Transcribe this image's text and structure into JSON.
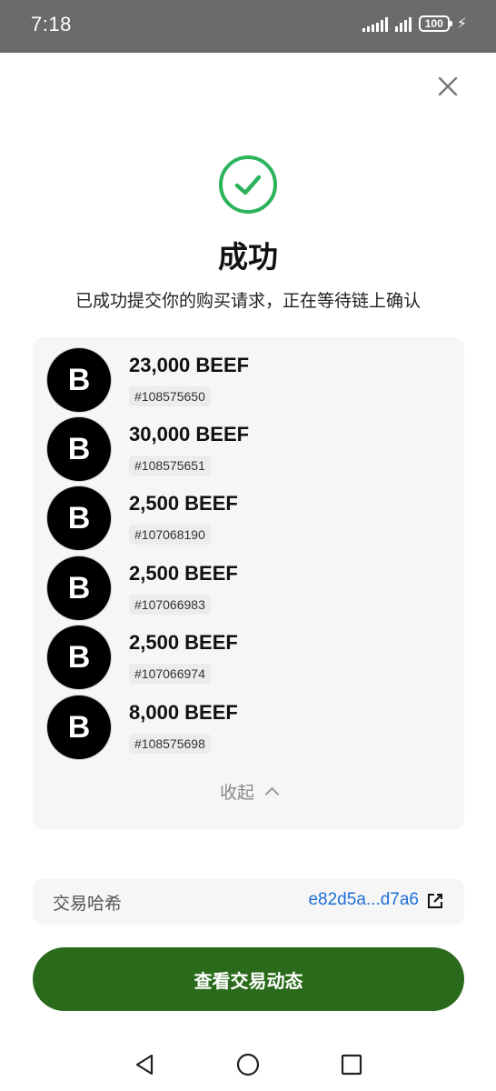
{
  "status_bar": {
    "time": "7:18",
    "battery": "100"
  },
  "result": {
    "title": "成功",
    "message": "已成功提交你的购买请求，正在等待链上确认"
  },
  "items": [
    {
      "avatar_letter": "B",
      "amount": "23,000 BEEF",
      "id": "#108575650"
    },
    {
      "avatar_letter": "B",
      "amount": "30,000 BEEF",
      "id": "#108575651"
    },
    {
      "avatar_letter": "B",
      "amount": "2,500 BEEF",
      "id": "#107068190"
    },
    {
      "avatar_letter": "B",
      "amount": "2,500 BEEF",
      "id": "#107066983"
    },
    {
      "avatar_letter": "B",
      "amount": "2,500 BEEF",
      "id": "#107066974"
    },
    {
      "avatar_letter": "B",
      "amount": "8,000 BEEF",
      "id": "#108575698"
    }
  ],
  "collapse_label": "收起",
  "hash": {
    "label": "交易哈希",
    "value": "e82d5a...d7a6"
  },
  "primary_button": "查看交易动态",
  "colors": {
    "success": "#2db35d",
    "primary": "#2a6b1b",
    "link": "#1f6fd6",
    "status_bar": "#6b6b6b"
  },
  "icons": {
    "success": "check-circle-icon",
    "close": "close-icon",
    "external": "external-link-icon"
  }
}
